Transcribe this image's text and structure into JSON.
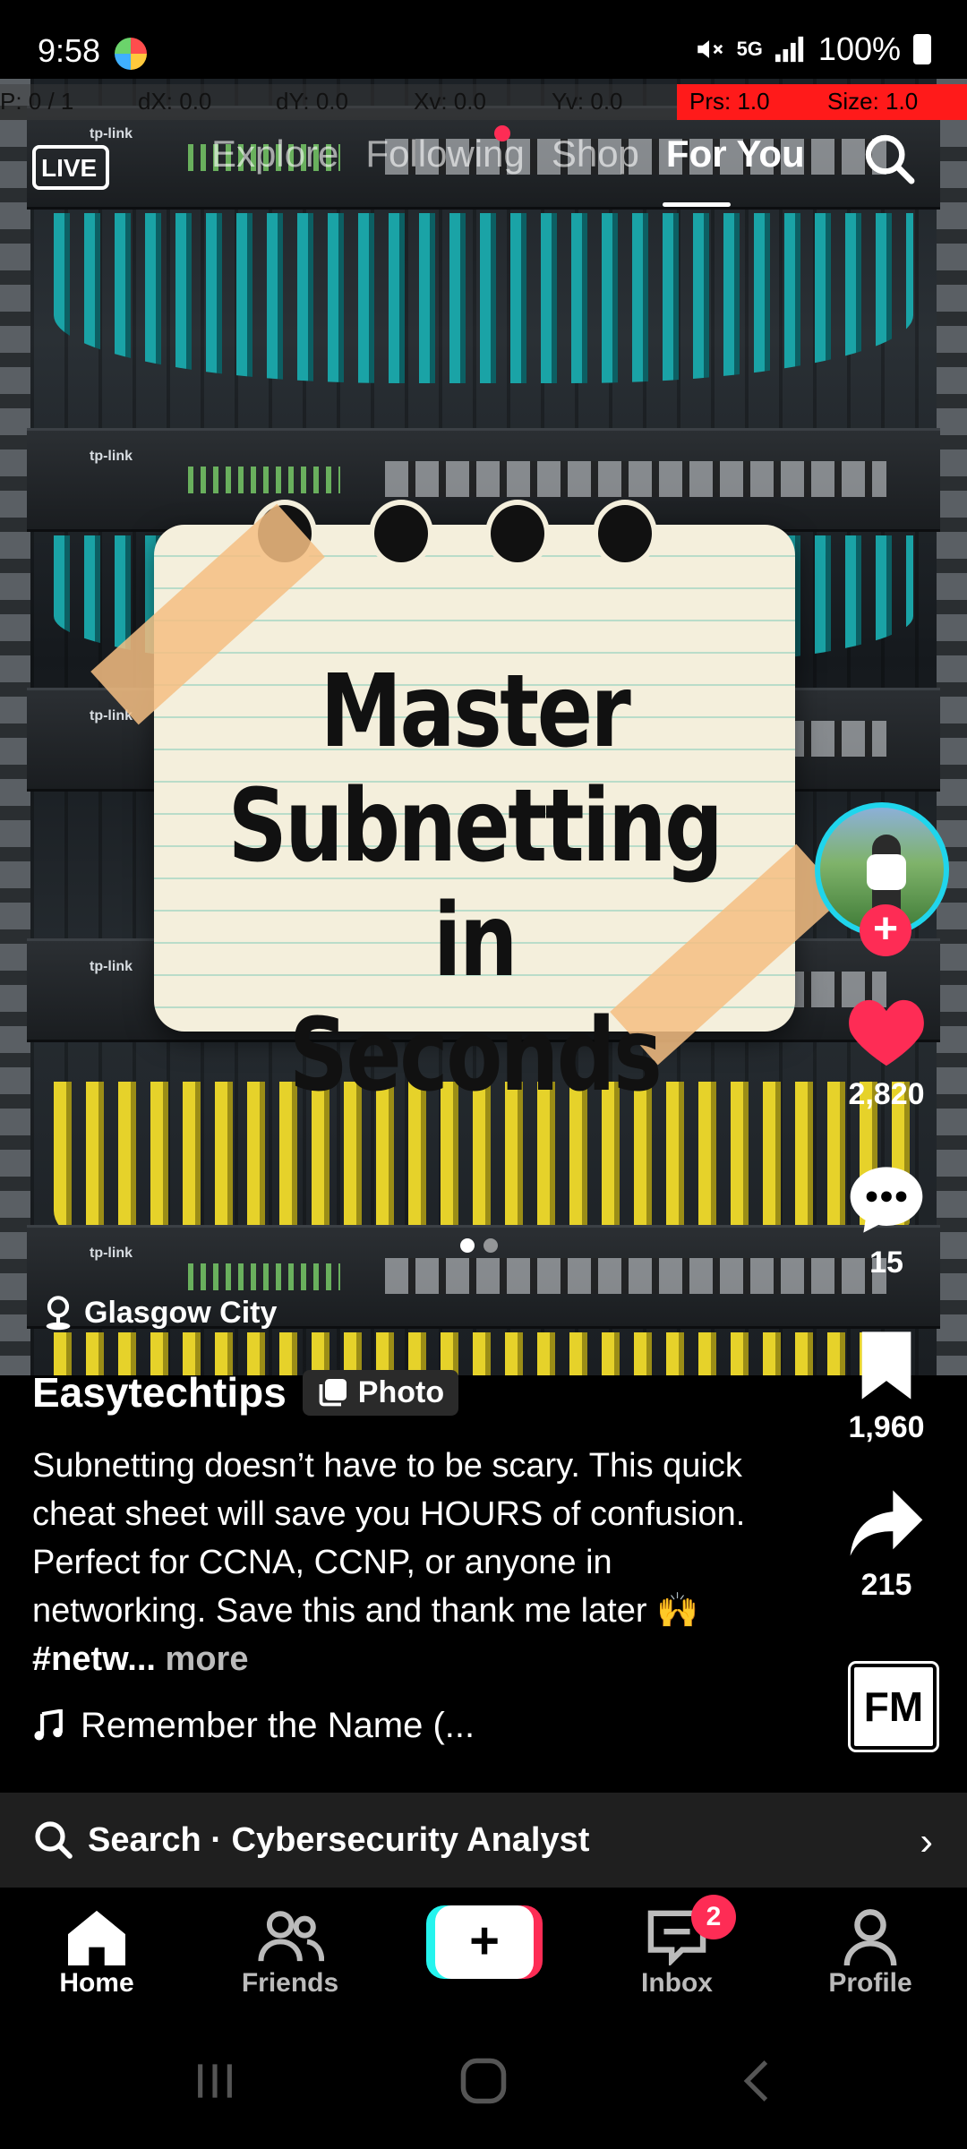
{
  "status_bar": {
    "time": "9:58",
    "network": "5G",
    "battery": "100%"
  },
  "debug_overlay": {
    "p": "P: 0 / 1",
    "dx": "dX: 0.0",
    "dy": "dY: 0.0",
    "xv": "Xv: 0.0",
    "yv": "Yv: 0.0",
    "prs": "Prs: 1.0",
    "size": "Size: 1.0"
  },
  "top_nav": {
    "live_label": "LIVE",
    "tabs": [
      "Explore",
      "Following",
      "Shop",
      "For You"
    ],
    "active_tab": "For You"
  },
  "post": {
    "title_lines": [
      "Master",
      "Subnetting in",
      "Seconds"
    ],
    "location": "Glasgow City",
    "username": "Easytechtips",
    "type_chip": "Photo",
    "caption_text": "Subnetting doesn’t have to be scary. This quick cheat sheet will save you HOURS of confusion. Perfect for CCNA, CCNP, or anyone in networking. Save this and thank me later 🙌",
    "caption_hashtag": "#netw...",
    "caption_more": "more",
    "sound": "Remember the Name (...",
    "slide_count": 2,
    "current_slide": 1
  },
  "actions": {
    "likes": "2,820",
    "comments": "15",
    "saves": "1,960",
    "shares": "215",
    "follow_symbol": "+"
  },
  "search_bar": {
    "label": "Search · Cybersecurity Analyst"
  },
  "bottom_nav": {
    "home": "Home",
    "friends": "Friends",
    "inbox": "Inbox",
    "profile": "Profile",
    "inbox_badge": "2",
    "create_symbol": "+"
  },
  "icons": {
    "like": "heart-icon",
    "comment": "comment-icon",
    "save": "bookmark-icon",
    "share": "share-arrow-icon",
    "search": "search-icon",
    "location": "location-pin-icon",
    "music": "music-note-icon"
  },
  "colors": {
    "accent_red": "#fe2c55",
    "accent_cyan": "#25f4ee",
    "debug_red": "#ff1a1a"
  }
}
